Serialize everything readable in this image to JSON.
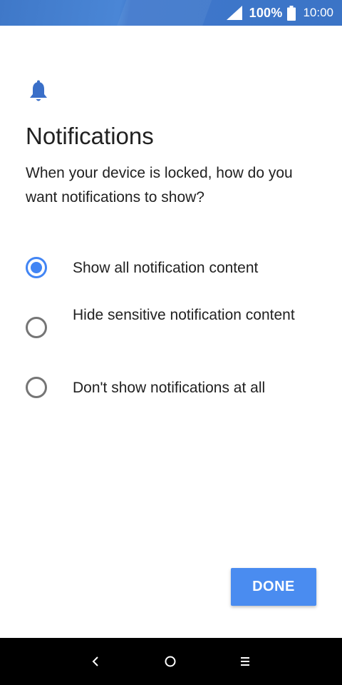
{
  "status_bar": {
    "battery_percent": "100%",
    "time": "10:00",
    "icons": [
      "signal-icon",
      "battery-icon"
    ],
    "background_color": "#3f78c8"
  },
  "header": {
    "icon": "bell-icon",
    "title": "Notifications",
    "subtitle": "When your device is locked, how do you want notifications to show?"
  },
  "options": [
    {
      "label": "Show all notification content",
      "selected": true
    },
    {
      "label": "Hide sensitive notification content",
      "selected": false
    },
    {
      "label": "Don't show notifications at all",
      "selected": false
    }
  ],
  "actions": {
    "done_label": "DONE"
  },
  "navigation": {
    "icons": [
      "back-icon",
      "home-icon",
      "menu-icon"
    ]
  },
  "colors": {
    "accent": "#4285f4",
    "button": "#4a8cf0",
    "text": "#212121"
  }
}
